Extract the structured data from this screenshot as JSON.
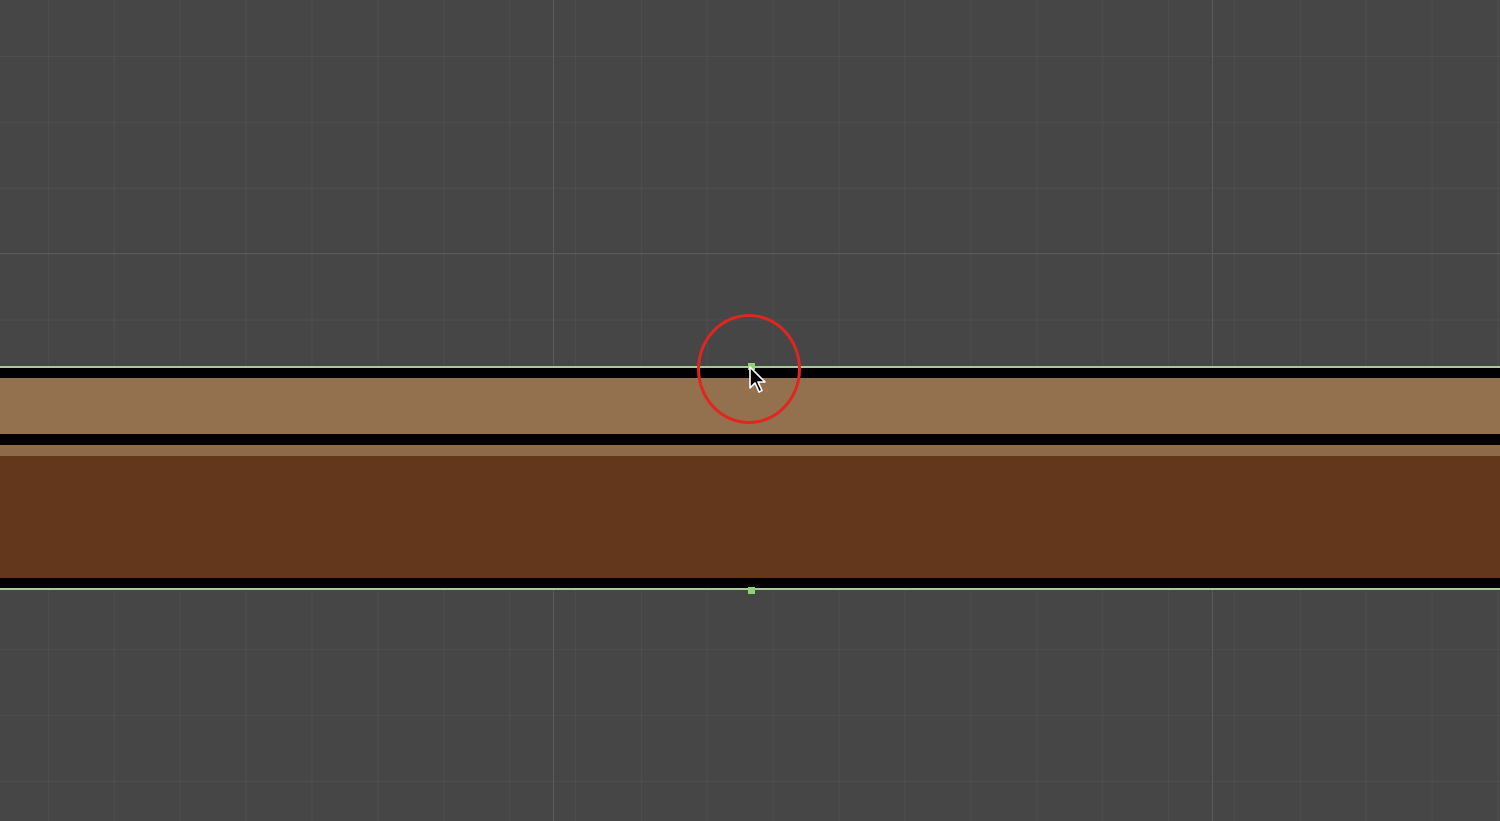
{
  "scene": {
    "background_color": "#464646",
    "grid": {
      "visible": true,
      "major_line_color": "#5a5a5a"
    }
  },
  "terrain": {
    "edge_line_color": "#a8c99a",
    "outline_color": "#000000",
    "grass_color": "#93704e",
    "grass_lip_color": "#8d6a49",
    "dirt_color": "#63371c"
  },
  "handles": {
    "color": "#8fd27a",
    "items": [
      {
        "name": "top-center-handle"
      },
      {
        "name": "bottom-center-handle"
      }
    ]
  },
  "highlight": {
    "color": "#e0261e"
  },
  "cursor": {
    "icon": "arrow-pointer-icon"
  }
}
